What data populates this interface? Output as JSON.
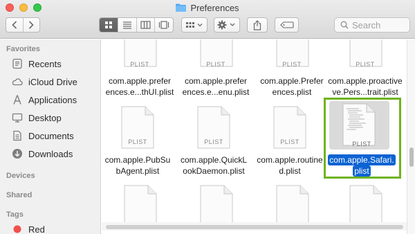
{
  "window": {
    "title": "Preferences"
  },
  "toolbar": {
    "search_placeholder": "Search"
  },
  "sidebar": {
    "sections": {
      "favorites": "Favorites",
      "devices": "Devices",
      "shared": "Shared",
      "tags": "Tags"
    },
    "favorites": [
      {
        "label": "Recents",
        "icon": "recents-icon"
      },
      {
        "label": "iCloud Drive",
        "icon": "cloud-icon"
      },
      {
        "label": "Applications",
        "icon": "applications-icon"
      },
      {
        "label": "Desktop",
        "icon": "desktop-icon"
      },
      {
        "label": "Documents",
        "icon": "documents-icon"
      },
      {
        "label": "Downloads",
        "icon": "downloads-icon"
      }
    ],
    "tags": [
      {
        "label": "Red",
        "color": "#f0504a"
      }
    ]
  },
  "files": {
    "type_label": "PLIST",
    "row1": [
      {
        "line1": "com.apple.prefer",
        "line2": "ences.e...thUI.plist"
      },
      {
        "line1": "com.apple.prefer",
        "line2": "ences.e...enu.plist"
      },
      {
        "line1": "com.apple.Prefer",
        "line2": "ences.plist"
      },
      {
        "line1": "com.apple.proactive",
        "line2": "ve.Pers...trait.plist"
      }
    ],
    "row2": [
      {
        "line1": "com.apple.PubSu",
        "line2": "bAgent.plist"
      },
      {
        "line1": "com.apple.QuickL",
        "line2": "ookDaemon.plist"
      },
      {
        "line1": "com.apple.routine",
        "line2": "d.plist"
      },
      {
        "line1": "com.apple.Safari.",
        "line2": "plist",
        "selected": true
      }
    ]
  },
  "colors": {
    "selection": "#0c63d3",
    "highlight_border": "#6fb31c"
  }
}
